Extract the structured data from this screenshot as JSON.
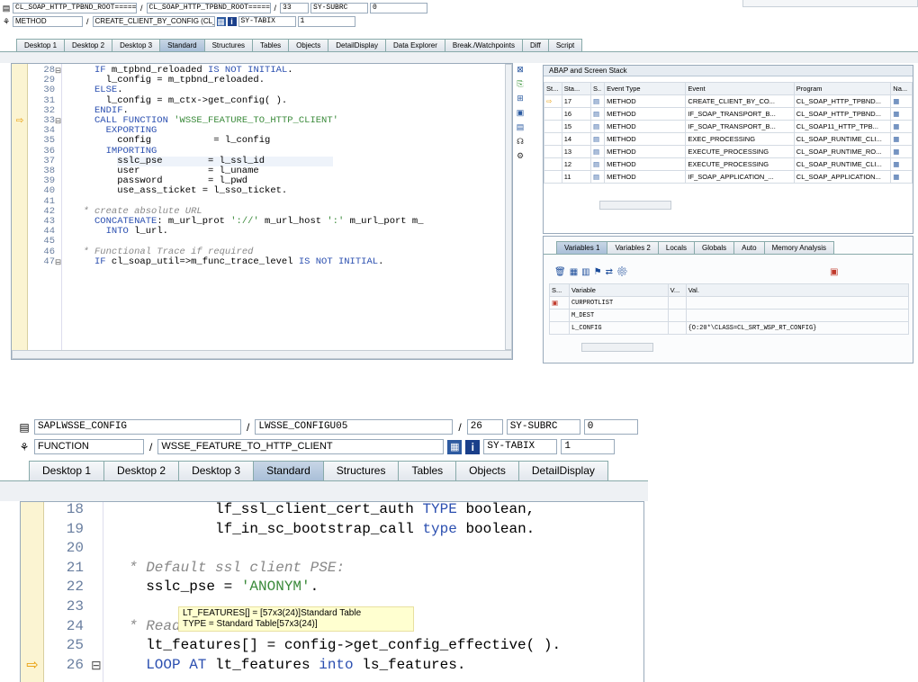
{
  "top": {
    "row1": {
      "program": "CL_SOAP_HTTP_TPBND_ROOT======",
      "include": "CL_SOAP_HTTP_TPBND_ROOT======",
      "line": "33",
      "sysfield": "SY-SUBRC",
      "sysvalue": "0"
    },
    "row2": {
      "type": "METHOD",
      "event": "CREATE_CLIENT_BY_CONFIG (CL_SOAP_HTTP_TPBND_",
      "sysfield": "SY-TABIX",
      "sysvalue": "1"
    },
    "tabs": [
      "Desktop 1",
      "Desktop 2",
      "Desktop 3",
      "Standard",
      "Structures",
      "Tables",
      "Objects",
      "DetailDisplay",
      "Data Explorer",
      "Break./Watchpoints",
      "Diff",
      "Script"
    ],
    "active_tab": "Standard",
    "code": [
      {
        "n": "28",
        "segs": [
          [
            "kw",
            "IF "
          ],
          [
            "",
            "m_tpbnd_reloaded "
          ],
          [
            "kw",
            "IS NOT INITIAL"
          ],
          [
            "",
            "."
          ]
        ],
        "indent": 0,
        "fold": "⊟"
      },
      {
        "n": "29",
        "segs": [
          [
            "",
            "l_config = m_tpbnd_reloaded."
          ]
        ],
        "indent": 2
      },
      {
        "n": "30",
        "segs": [
          [
            "kw",
            "ELSE"
          ],
          [
            "",
            "."
          ]
        ],
        "indent": 0
      },
      {
        "n": "31",
        "segs": [
          [
            "",
            "l_config = m_ctx->get_config( )."
          ]
        ],
        "indent": 2
      },
      {
        "n": "32",
        "segs": [
          [
            "kw",
            "ENDIF"
          ],
          [
            "",
            "."
          ]
        ],
        "indent": 0
      },
      {
        "n": "33",
        "segs": [
          [
            "kw",
            "CALL FUNCTION "
          ],
          [
            "str",
            "'WSSE_FEATURE_TO_HTTP_CLIENT'"
          ]
        ],
        "indent": 0,
        "fold": "⊟",
        "current": true
      },
      {
        "n": "34",
        "segs": [
          [
            "kw",
            "EXPORTING"
          ]
        ],
        "indent": 2
      },
      {
        "n": "35",
        "segs": [
          [
            "",
            "config           = l_config"
          ]
        ],
        "indent": 4
      },
      {
        "n": "36",
        "segs": [
          [
            "kw",
            "IMPORTING"
          ]
        ],
        "indent": 2
      },
      {
        "n": "37",
        "segs": [
          [
            "",
            "sslc_pse        = l_ssl_id"
          ]
        ],
        "indent": 4,
        "cursor": true
      },
      {
        "n": "38",
        "segs": [
          [
            "",
            "user            = l_uname"
          ]
        ],
        "indent": 4
      },
      {
        "n": "39",
        "segs": [
          [
            "",
            "password        = l_pwd"
          ]
        ],
        "indent": 4
      },
      {
        "n": "40",
        "segs": [
          [
            "",
            "use_ass_ticket = l_sso_ticket."
          ]
        ],
        "indent": 4
      },
      {
        "n": "41",
        "segs": [
          [
            "",
            ""
          ]
        ],
        "indent": 0
      },
      {
        "n": "42",
        "segs": [
          [
            "cmt",
            "* create absolute URL"
          ]
        ],
        "indent": -2
      },
      {
        "n": "43",
        "segs": [
          [
            "kw",
            "CONCATENATE"
          ],
          [
            "",
            ": m_url_prot "
          ],
          [
            "str",
            "'://'"
          ],
          [
            "",
            " m_url_host "
          ],
          [
            "str",
            "':'"
          ],
          [
            "",
            " m_url_port m_"
          ]
        ],
        "indent": 0
      },
      {
        "n": "44",
        "segs": [
          [
            "kw",
            "INTO "
          ],
          [
            "",
            "l_url."
          ]
        ],
        "indent": 2
      },
      {
        "n": "45",
        "segs": [
          [
            "",
            ""
          ]
        ],
        "indent": 0
      },
      {
        "n": "46",
        "segs": [
          [
            "cmt",
            "* Functional Trace if required"
          ]
        ],
        "indent": -2
      },
      {
        "n": "47",
        "segs": [
          [
            "kw",
            "IF "
          ],
          [
            "",
            "cl_soap_util=>m_func_trace_level "
          ],
          [
            "kw",
            "IS NOT INITIAL"
          ],
          [
            "",
            "."
          ]
        ],
        "indent": 0,
        "fold": "⊟"
      }
    ],
    "stack": {
      "title": "ABAP and Screen Stack",
      "headers": [
        "St...",
        "Sta...",
        "S..",
        "Event Type",
        "Event",
        "Program",
        "Na..."
      ],
      "rows": [
        {
          "marker": "⇨",
          "level": "17",
          "type": "METHOD",
          "event": "CREATE_CLIENT_BY_CO...",
          "program": "CL_SOAP_HTTP_TPBND..."
        },
        {
          "marker": "",
          "level": "16",
          "type": "METHOD",
          "event": "IF_SOAP_TRANSPORT_B...",
          "program": "CL_SOAP_HTTP_TPBND..."
        },
        {
          "marker": "",
          "level": "15",
          "type": "METHOD",
          "event": "IF_SOAP_TRANSPORT_B...",
          "program": "CL_SOAP11_HTTP_TPB..."
        },
        {
          "marker": "",
          "level": "14",
          "type": "METHOD",
          "event": "EXEC_PROCESSING",
          "program": "CL_SOAP_RUNTIME_CLI..."
        },
        {
          "marker": "",
          "level": "13",
          "type": "METHOD",
          "event": "EXECUTE_PROCESSING",
          "program": "CL_SOAP_RUNTIME_RO..."
        },
        {
          "marker": "",
          "level": "12",
          "type": "METHOD",
          "event": "EXECUTE_PROCESSING",
          "program": "CL_SOAP_RUNTIME_CLI..."
        },
        {
          "marker": "",
          "level": "11",
          "type": "METHOD",
          "event": "IF_SOAP_APPLICATION_...",
          "program": "CL_SOAP_APPLICATION..."
        }
      ]
    },
    "var_tabs": [
      "Variables 1",
      "Variables 2",
      "Locals",
      "Globals",
      "Auto",
      "Memory Analysis"
    ],
    "active_var_tab": "Variables 1",
    "vars": {
      "headers": [
        "S...",
        "Variable",
        "V...",
        "Val."
      ],
      "rows": [
        {
          "icon": "▣",
          "name": "CURPROTLIST",
          "value": ""
        },
        {
          "icon": "",
          "name": "M_DEST",
          "value": ""
        },
        {
          "icon": "",
          "name": "L_CONFIG",
          "value": "{O:20*\\CLASS=CL_SRT_WSP_RT_CONFIG}"
        }
      ]
    }
  },
  "bottom": {
    "row1": {
      "program": "SAPLWSSE_CONFIG",
      "include": "LWSSE_CONFIGU05",
      "line": "26",
      "sysfield": "SY-SUBRC",
      "sysvalue": "0"
    },
    "row2": {
      "type": "FUNCTION",
      "event": "WSSE_FEATURE_TO_HTTP_CLIENT",
      "sysfield": "SY-TABIX",
      "sysvalue": "1"
    },
    "tabs": [
      "Desktop 1",
      "Desktop 2",
      "Desktop 3",
      "Standard",
      "Structures",
      "Tables",
      "Objects",
      "DetailDisplay"
    ],
    "active_tab": "Standard",
    "code": [
      {
        "n": "18",
        "segs": [
          [
            "",
            "lf_ssl_client_cert_auth "
          ],
          [
            "kw",
            "TYPE "
          ],
          [
            "",
            "boolean,"
          ]
        ],
        "indent": 10
      },
      {
        "n": "19",
        "segs": [
          [
            "",
            "lf_in_sc_bootstrap_call "
          ],
          [
            "kw",
            "type "
          ],
          [
            "",
            "boolean."
          ]
        ],
        "indent": 10
      },
      {
        "n": "20",
        "segs": [
          [
            "",
            ""
          ]
        ],
        "indent": 0
      },
      {
        "n": "21",
        "segs": [
          [
            "cmt",
            "* Default ssl client PSE:"
          ]
        ],
        "indent": 0
      },
      {
        "n": "22",
        "segs": [
          [
            "",
            "sslc_pse = "
          ],
          [
            "str",
            "'ANONYM'"
          ],
          [
            "",
            "."
          ]
        ],
        "indent": 2
      },
      {
        "n": "23",
        "segs": [
          [
            "",
            ""
          ]
        ],
        "indent": 0
      },
      {
        "n": "24",
        "segs": [
          [
            "cmt",
            "* Read"
          ]
        ],
        "indent": 0
      },
      {
        "n": "25",
        "segs": [
          [
            "",
            "lt_features[] = config->get_config_effective( )."
          ]
        ],
        "indent": 2
      },
      {
        "n": "26",
        "segs": [
          [
            "kw",
            "LOOP AT "
          ],
          [
            "",
            "lt_features "
          ],
          [
            "kw",
            "into "
          ],
          [
            "",
            "ls_features."
          ]
        ],
        "indent": 2,
        "current": true,
        "fold": "⊟"
      }
    ],
    "tooltip": {
      "line1": "LT_FEATURES[] = [57x3(24)]Standard Table",
      "line2": "TYPE = Standard Table[57x3(24)]"
    }
  }
}
